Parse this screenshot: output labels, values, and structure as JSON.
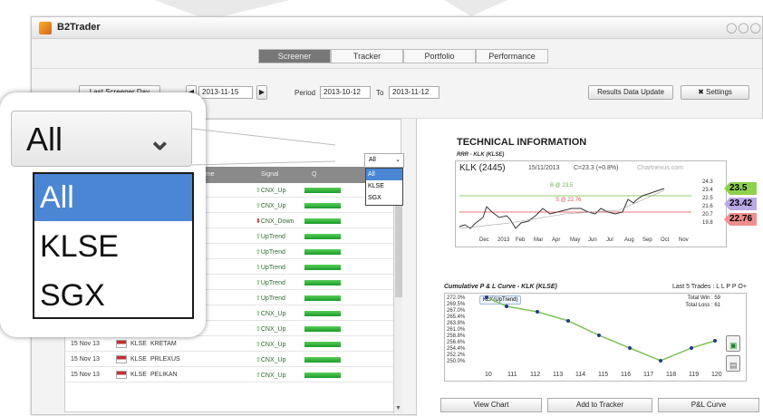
{
  "app": {
    "title": "B2Trader"
  },
  "tabs": [
    {
      "label": "Screener",
      "active": true
    },
    {
      "label": "Tracker"
    },
    {
      "label": "Portfolio"
    },
    {
      "label": "Performance"
    }
  ],
  "toolbar": {
    "last_screener_day_label": "Last Screener Day",
    "date": "2013-11-15",
    "period_label": "Period",
    "period_from": "2013-10-12",
    "to_label": "To",
    "period_to": "2013-11-12",
    "results_update_label": "Results Data Update",
    "settings_label": "Settings"
  },
  "exchange_select": {
    "value": "All",
    "options": [
      "All",
      "KLSE",
      "SGX"
    ],
    "selected": "All"
  },
  "grid": {
    "headers": {
      "name": "Name",
      "signal": "Signal",
      "q": "Q"
    },
    "rows": [
      {
        "signal": "CNX_Up"
      },
      {
        "signal": "CNX_Up"
      },
      {
        "signal": "CNX_Down",
        "down": true
      },
      {
        "signal": "UpTrend"
      },
      {
        "signal": "UpTrend"
      },
      {
        "signal": "UpTrend"
      },
      {
        "signal": "UpTrend"
      },
      {
        "signal": "UpTrend"
      },
      {
        "signal": "CNX_Up"
      },
      {
        "date": "15 Nov 13",
        "mkt": "KLSE",
        "name": "SIME",
        "signal": "CNX_Up"
      },
      {
        "date": "15 Nov 13",
        "mkt": "KLSE",
        "name": "KRETAM",
        "signal": "CNX_Up"
      },
      {
        "date": "15 Nov 13",
        "mkt": "KLSE",
        "name": "PRLEXUS",
        "signal": "CNX_Up"
      },
      {
        "date": "15 Nov 13",
        "mkt": "KLSE",
        "name": "PELIKAN",
        "signal": "CNX_Up"
      }
    ]
  },
  "technical": {
    "title": "TECHNICAL INFORMATION",
    "subtitle": "RRR - KLK (KLSE)",
    "symbol": "KLK (2445)",
    "chart_date": "15/11/2013",
    "change": "C=23.3 (+0.8%)",
    "watermark": "Chartnexus.com",
    "price_labels": [
      "24.3",
      "23.4",
      "22.5",
      "21.6",
      "20.7",
      "19.8"
    ],
    "line_b_label": "B @ 23.5",
    "line_s_label": "S @ 22.76",
    "months": [
      "Dec",
      "2013",
      "Feb",
      "Mar",
      "Apr",
      "May",
      "Jun",
      "Jul",
      "Aug",
      "Sep",
      "Oct",
      "Nov"
    ],
    "badges": [
      {
        "value": "23.5",
        "color": "#8ed14c"
      },
      {
        "value": "23.42",
        "color": "#b9a9e6"
      },
      {
        "value": "22.76",
        "color": "#f08e8e"
      }
    ]
  },
  "pnl": {
    "title": "Cumulative P & L Curve - KLK (KLSE)",
    "last5_label": "Last 5 Trades : L L P P O+",
    "legend": "KLK(UpTrend)",
    "total_win": "Total Win : 59",
    "total_loss": "Total Loss : 61",
    "y_ticks": [
      "272.0%",
      "269.5%",
      "267.0%",
      "265.4%",
      "263.8%",
      "261.0%",
      "258.8%",
      "256.6%",
      "254.4%",
      "252.2%",
      "250.0%"
    ],
    "x_ticks": [
      "10",
      "111",
      "112",
      "113",
      "114",
      "115",
      "116",
      "117",
      "118",
      "119",
      "120"
    ]
  },
  "bottom_buttons": {
    "view_chart": "View Chart",
    "add_tracker": "Add to Tracker",
    "pl_curve": "P&L Curve"
  }
}
